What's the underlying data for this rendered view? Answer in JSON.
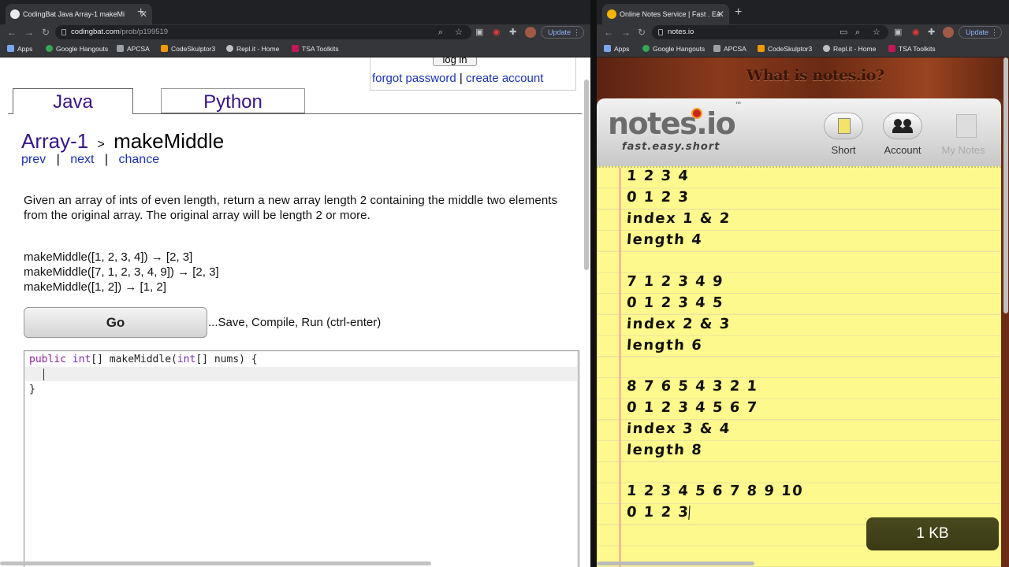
{
  "left_browser": {
    "tab_title": "CodingBat Java Array-1 makeMi",
    "url_host": "codingbat.com",
    "url_path": "/prob/p199519",
    "update_label": "Update",
    "bookmarks": [
      "Apps",
      "Google Hangouts",
      "APCSA",
      "CodeSkulptor3",
      "Repl.it - Home",
      "TSA Toolkits"
    ]
  },
  "right_browser": {
    "tab_title": "Online Notes Service | Fast . Ea",
    "url": "notes.io",
    "update_label": "Update",
    "bookmarks": [
      "Apps",
      "Google Hangouts",
      "APCSA",
      "CodeSkulptor3",
      "Repl.it - Home",
      "TSA Toolkits"
    ]
  },
  "codingbat": {
    "login_label": "log in",
    "forgot_password": "forgot password",
    "separator": "|",
    "create_account": "create account",
    "tabs": [
      "Java",
      "Python"
    ],
    "category": "Array-1",
    "crumb_sep": ">",
    "problem": "makeMiddle",
    "nav": {
      "prev": "prev",
      "next": "next",
      "chance": "chance",
      "sep": "|"
    },
    "description": "Given an array of ints of even length, return a new array length 2 containing the middle two elements from the original array. The original array will be length 2 or more.",
    "examples": [
      "makeMiddle([1, 2, 3, 4]) → [2, 3]",
      "makeMiddle([7, 1, 2, 3, 4, 9]) → [2, 3]",
      "makeMiddle([1, 2]) → [1, 2]"
    ],
    "go_label": "Go",
    "go_hint": "...Save, Compile, Run (ctrl-enter)",
    "code": {
      "kw_public": "public",
      "ty_int": "int",
      "sig_mid": "[] makeMiddle(",
      "ty_int2": "int",
      "sig_end": "[] nums) {",
      "close": "}"
    }
  },
  "notes": {
    "banner": "What is notes.io?",
    "logo": "notes.io",
    "tm": "™",
    "tagline": "fast.easy.short",
    "nav": [
      "Short",
      "Account",
      "My Notes"
    ],
    "lines": [
      "1 2 3 4",
      "0 1 2 3",
      "index 1 & 2",
      "length 4",
      "",
      "7 1 2 3 4 9",
      "0 1 2 3 4 5",
      "index 2 & 3",
      "length 6",
      "",
      "8 7 6 5 4 3 2 1",
      "0 1 2 3 4 5 6 7",
      "index 3 & 4",
      "length 8",
      "",
      "1 2 3 4 5 6 7 8 9 10",
      "0 1 2 3"
    ],
    "size": "1 KB"
  },
  "colors": {
    "chrome_dark": "#202124",
    "chrome_toolbar": "#35363a",
    "codingbat_purple": "#3a1486",
    "link_blue": "#1a33b0",
    "paper_yellow": "#fef98c"
  }
}
